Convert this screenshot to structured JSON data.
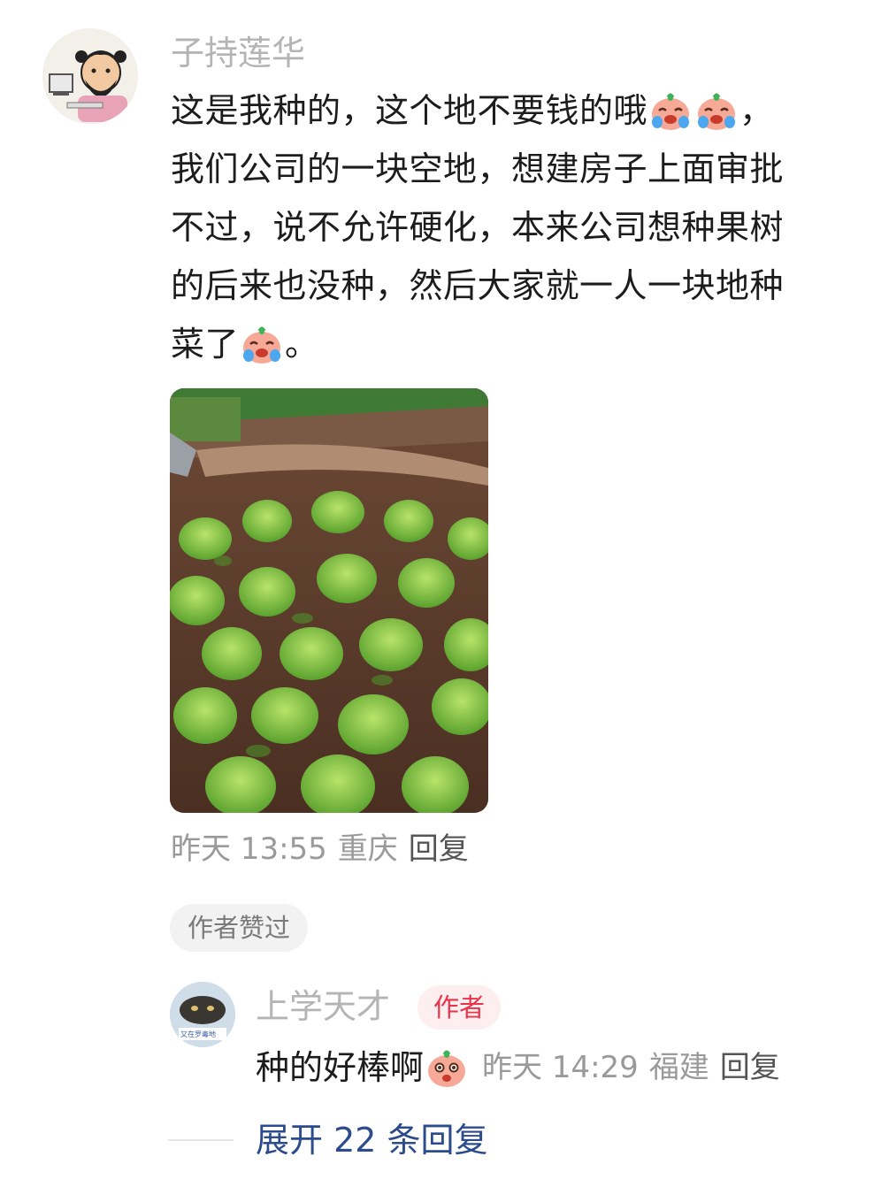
{
  "main_comment": {
    "username": "子持莲华",
    "lines": [
      [
        "这是我种的，这个地不要钱的哦",
        "emoji",
        "emoji",
        "，"
      ],
      [
        "我们公司的一块空地，想建房子上面审批"
      ],
      [
        "不过，说不允许硬化，本来公司想种果树"
      ],
      [
        "的后来也没种，然后大家就一人一块地种"
      ],
      [
        "菜了",
        "emoji",
        "。"
      ]
    ],
    "time": "昨天 13:55",
    "location": "重庆",
    "reply_label": "回复",
    "liked_chip": "作者赞过"
  },
  "reply": {
    "username": "上学天才",
    "badge": "作者",
    "text": "种的好棒啊",
    "time": "昨天 14:29",
    "location": "福建",
    "reply_label": "回复",
    "avatar_caption": "又在罗毒地"
  },
  "expand_label": "展开 22 条回复",
  "colors": {
    "name_gray": "#b4b4b4",
    "meta_gray": "#9a9a9a",
    "link_blue": "#2b4b8c",
    "badge_red": "#e8334a"
  }
}
